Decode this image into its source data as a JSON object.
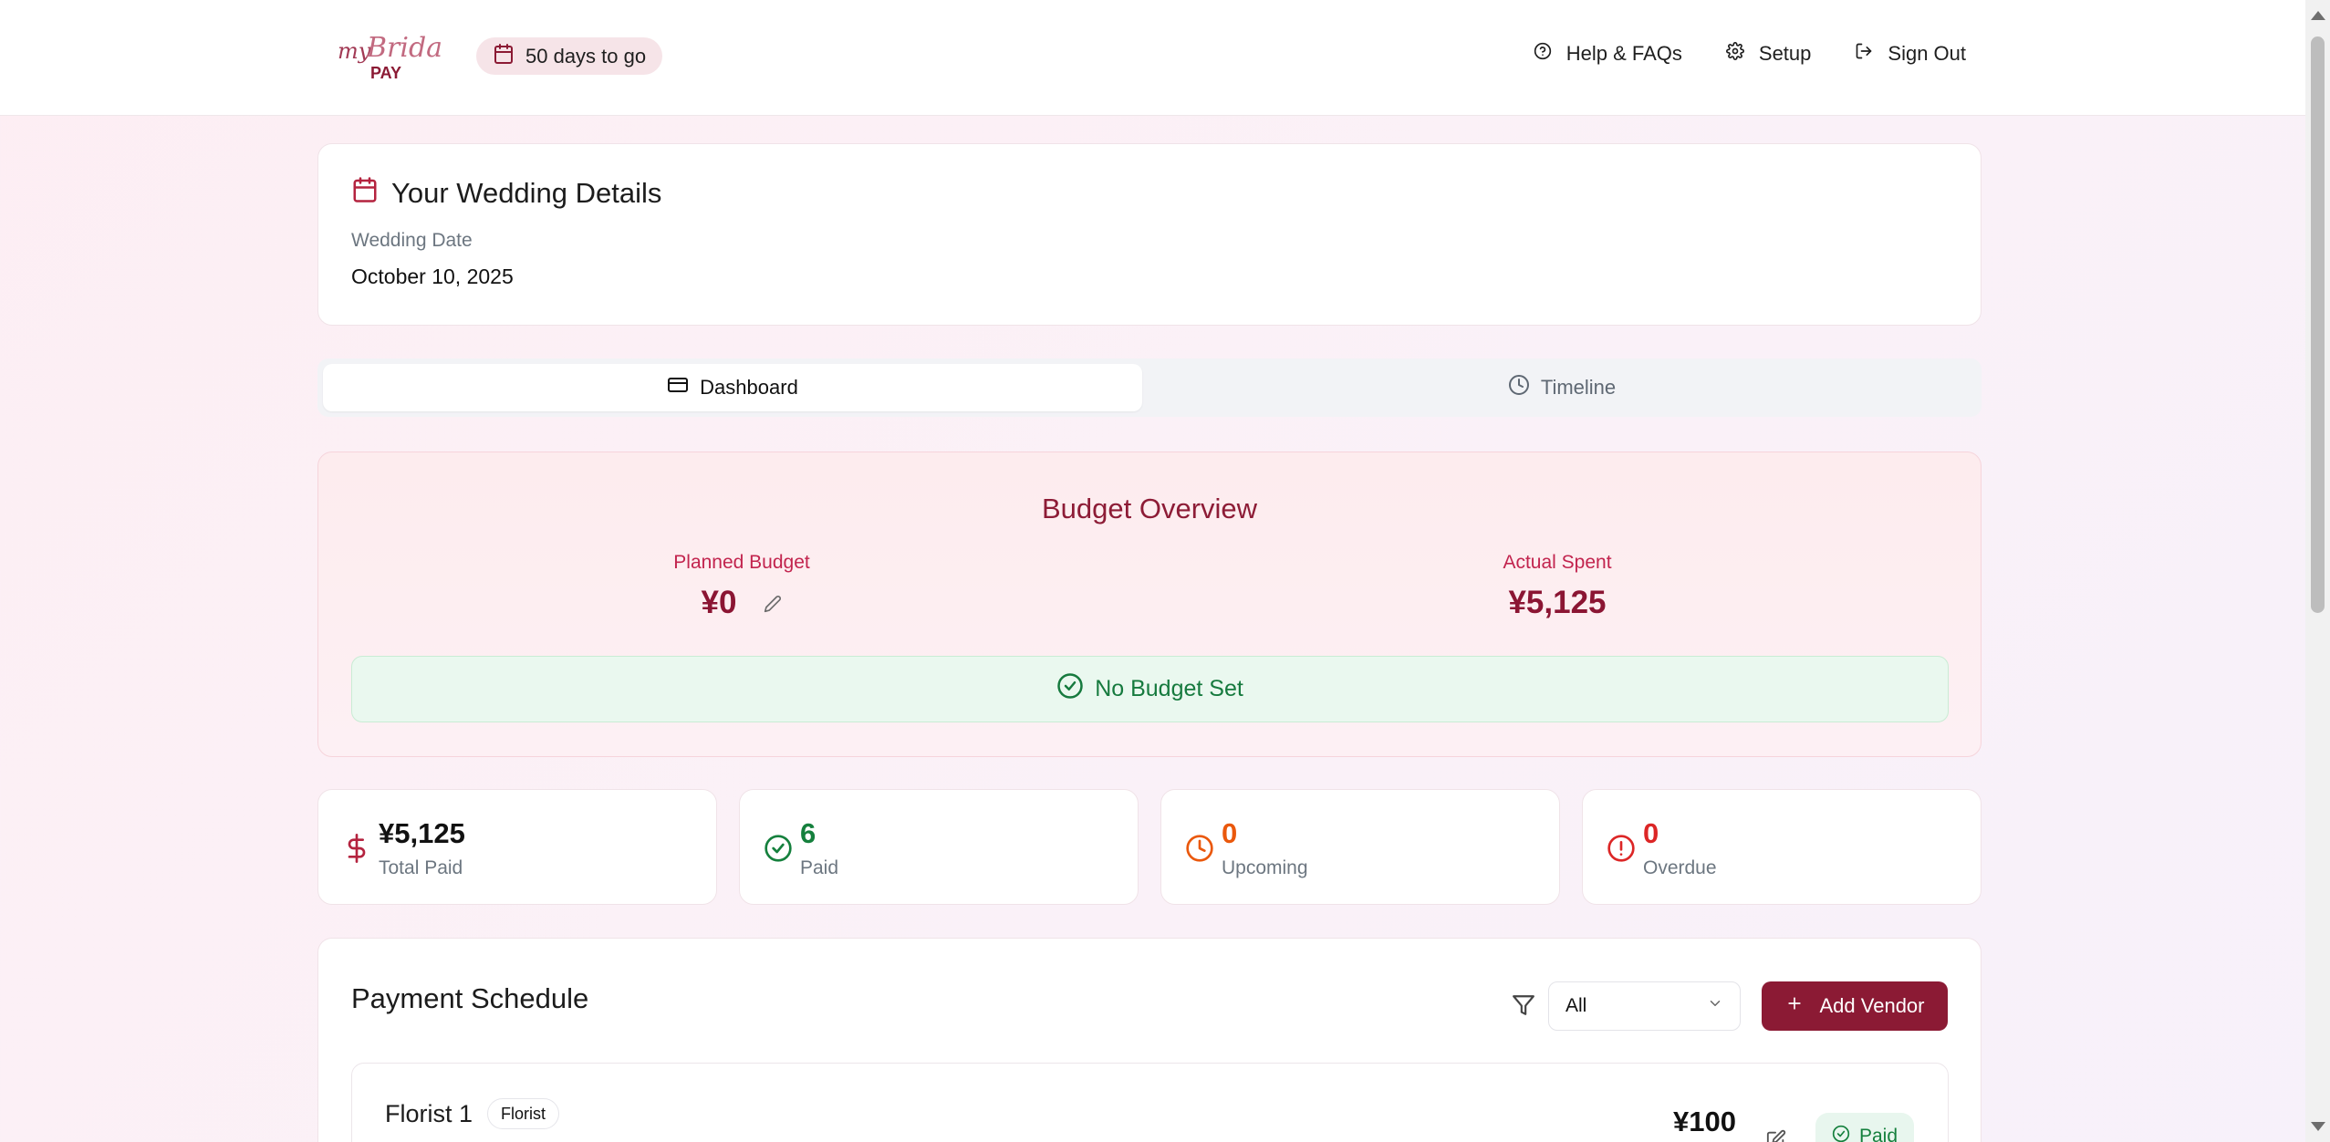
{
  "header": {
    "logo_text": "my Bridal PAY",
    "countdown": "50 days to go",
    "nav": [
      {
        "label": "Help & FAQs",
        "icon": "help-circle-icon"
      },
      {
        "label": "Setup",
        "icon": "gear-icon"
      },
      {
        "label": "Sign Out",
        "icon": "sign-out-icon"
      }
    ]
  },
  "wedding": {
    "title": "Your Wedding Details",
    "date_label": "Wedding Date",
    "date_value": "October 10, 2025"
  },
  "tabs": [
    {
      "label": "Dashboard",
      "icon": "credit-card-icon",
      "active": true
    },
    {
      "label": "Timeline",
      "icon": "clock-icon",
      "active": false
    }
  ],
  "budget": {
    "title": "Budget Overview",
    "planned_label": "Planned Budget",
    "planned_value": "¥0",
    "actual_label": "Actual Spent",
    "actual_value": "¥5,125",
    "status": "No Budget Set"
  },
  "stats": [
    {
      "value": "¥5,125",
      "caption": "Total Paid",
      "color": "#111111",
      "icon": "dollar-icon"
    },
    {
      "value": "6",
      "caption": "Paid",
      "color": "#15803d",
      "icon": "check-circle-icon"
    },
    {
      "value": "0",
      "caption": "Upcoming",
      "color": "#ea580c",
      "icon": "clock-icon"
    },
    {
      "value": "0",
      "caption": "Overdue",
      "color": "#dc2626",
      "icon": "alert-circle-icon"
    }
  ],
  "payment": {
    "title": "Payment Schedule",
    "filter_value": "All",
    "add_vendor_label": "Add Vendor",
    "vendors": [
      {
        "name": "Florist 1",
        "category": "Florist",
        "amount": "¥100",
        "status": "Paid"
      }
    ]
  },
  "colors": {
    "brand": "#8b1a34",
    "accent_text": "#c2244e",
    "success": "#15803d"
  }
}
